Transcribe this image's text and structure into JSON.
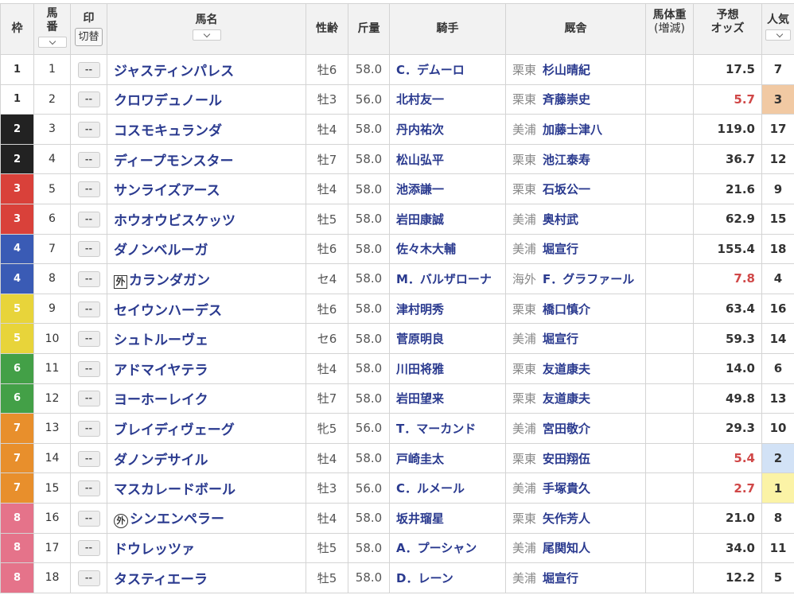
{
  "headers": {
    "waku": "枠",
    "umaban_1": "馬",
    "umaban_2": "番",
    "mark": "印",
    "mark_switch": "切替",
    "horse": "馬名",
    "sexage": "性齢",
    "weight": "斤量",
    "jockey": "騎手",
    "trainer": "厩舎",
    "body_1": "馬体重",
    "body_2": "(増減)",
    "odds_1": "予想",
    "odds_2": "オッズ",
    "pop": "人気"
  },
  "mark_placeholder": "--",
  "waku_colors": {
    "1": {
      "bg": "#ffffff",
      "fg": "#333333"
    },
    "2": {
      "bg": "#222222",
      "fg": "#ffffff"
    },
    "3": {
      "bg": "#d9413a",
      "fg": "#ffffff"
    },
    "4": {
      "bg": "#3a5bb5",
      "fg": "#ffffff"
    },
    "5": {
      "bg": "#e8d43a",
      "fg": "#ffffff"
    },
    "6": {
      "bg": "#43a047",
      "fg": "#ffffff"
    },
    "7": {
      "bg": "#e88f2c",
      "fg": "#ffffff"
    },
    "8": {
      "bg": "#e5738a",
      "fg": "#ffffff"
    }
  },
  "pop_colors": {
    "1": "#fbf3a6",
    "2": "#d2e2f6",
    "3": "#f1c9a3"
  },
  "rows": [
    {
      "waku": "1",
      "num": "1",
      "tag": "",
      "horse": "ジャスティンパレス",
      "sexage": "牡6",
      "weight": "58.0",
      "jockey": "C．デムーロ",
      "region": "栗東",
      "trainer": "杉山晴紀",
      "body": "",
      "odds": "17.5",
      "hot": false,
      "pop": "7"
    },
    {
      "waku": "1",
      "num": "2",
      "tag": "",
      "horse": "クロワデュノール",
      "sexage": "牡3",
      "weight": "56.0",
      "jockey": "北村友一",
      "region": "栗東",
      "trainer": "斉藤崇史",
      "body": "",
      "odds": "5.7",
      "hot": true,
      "pop": "3"
    },
    {
      "waku": "2",
      "num": "3",
      "tag": "",
      "horse": "コスモキュランダ",
      "sexage": "牡4",
      "weight": "58.0",
      "jockey": "丹内祐次",
      "region": "美浦",
      "trainer": "加藤士津八",
      "body": "",
      "odds": "119.0",
      "hot": false,
      "pop": "17"
    },
    {
      "waku": "2",
      "num": "4",
      "tag": "",
      "horse": "ディープモンスター",
      "sexage": "牡7",
      "weight": "58.0",
      "jockey": "松山弘平",
      "region": "栗東",
      "trainer": "池江泰寿",
      "body": "",
      "odds": "36.7",
      "hot": false,
      "pop": "12"
    },
    {
      "waku": "3",
      "num": "5",
      "tag": "",
      "horse": "サンライズアース",
      "sexage": "牡4",
      "weight": "58.0",
      "jockey": "池添謙一",
      "region": "栗東",
      "trainer": "石坂公一",
      "body": "",
      "odds": "21.6",
      "hot": false,
      "pop": "9"
    },
    {
      "waku": "3",
      "num": "6",
      "tag": "",
      "horse": "ホウオウビスケッツ",
      "sexage": "牡5",
      "weight": "58.0",
      "jockey": "岩田康誠",
      "region": "美浦",
      "trainer": "奥村武",
      "body": "",
      "odds": "62.9",
      "hot": false,
      "pop": "15"
    },
    {
      "waku": "4",
      "num": "7",
      "tag": "",
      "horse": "ダノンベルーガ",
      "sexage": "牡6",
      "weight": "58.0",
      "jockey": "佐々木大輔",
      "region": "美浦",
      "trainer": "堀宣行",
      "body": "",
      "odds": "155.4",
      "hot": false,
      "pop": "18"
    },
    {
      "waku": "4",
      "num": "8",
      "tag": "外",
      "tagStyle": "box",
      "horse": "カランダガン",
      "sexage": "セ4",
      "weight": "58.0",
      "jockey": "M．バルザローナ",
      "region": "海外",
      "trainer": "F．グラファール",
      "body": "",
      "odds": "7.8",
      "hot": true,
      "pop": "4"
    },
    {
      "waku": "5",
      "num": "9",
      "tag": "",
      "horse": "セイウンハーデス",
      "sexage": "牡6",
      "weight": "58.0",
      "jockey": "津村明秀",
      "region": "栗東",
      "trainer": "橋口慎介",
      "body": "",
      "odds": "63.4",
      "hot": false,
      "pop": "16"
    },
    {
      "waku": "5",
      "num": "10",
      "tag": "",
      "horse": "シュトルーヴェ",
      "sexage": "セ6",
      "weight": "58.0",
      "jockey": "菅原明良",
      "region": "美浦",
      "trainer": "堀宣行",
      "body": "",
      "odds": "59.3",
      "hot": false,
      "pop": "14"
    },
    {
      "waku": "6",
      "num": "11",
      "tag": "",
      "horse": "アドマイヤテラ",
      "sexage": "牡4",
      "weight": "58.0",
      "jockey": "川田将雅",
      "region": "栗東",
      "trainer": "友道康夫",
      "body": "",
      "odds": "14.0",
      "hot": false,
      "pop": "6"
    },
    {
      "waku": "6",
      "num": "12",
      "tag": "",
      "horse": "ヨーホーレイク",
      "sexage": "牡7",
      "weight": "58.0",
      "jockey": "岩田望来",
      "region": "栗東",
      "trainer": "友道康夫",
      "body": "",
      "odds": "49.8",
      "hot": false,
      "pop": "13"
    },
    {
      "waku": "7",
      "num": "13",
      "tag": "",
      "horse": "ブレイディヴェーグ",
      "sexage": "牝5",
      "weight": "56.0",
      "jockey": "T．マーカンド",
      "region": "美浦",
      "trainer": "宮田敬介",
      "body": "",
      "odds": "29.3",
      "hot": false,
      "pop": "10"
    },
    {
      "waku": "7",
      "num": "14",
      "tag": "",
      "horse": "ダノンデサイル",
      "sexage": "牡4",
      "weight": "58.0",
      "jockey": "戸崎圭太",
      "region": "栗東",
      "trainer": "安田翔伍",
      "body": "",
      "odds": "5.4",
      "hot": true,
      "pop": "2"
    },
    {
      "waku": "7",
      "num": "15",
      "tag": "",
      "horse": "マスカレードボール",
      "sexage": "牡3",
      "weight": "56.0",
      "jockey": "C．ルメール",
      "region": "美浦",
      "trainer": "手塚貴久",
      "body": "",
      "odds": "2.7",
      "hot": true,
      "pop": "1"
    },
    {
      "waku": "8",
      "num": "16",
      "tag": "外",
      "tagStyle": "circle",
      "horse": "シンエンペラー",
      "sexage": "牡4",
      "weight": "58.0",
      "jockey": "坂井瑠星",
      "region": "栗東",
      "trainer": "矢作芳人",
      "body": "",
      "odds": "21.0",
      "hot": false,
      "pop": "8"
    },
    {
      "waku": "8",
      "num": "17",
      "tag": "",
      "horse": "ドウレッツァ",
      "sexage": "牡5",
      "weight": "58.0",
      "jockey": "A．プーシャン",
      "region": "美浦",
      "trainer": "尾関知人",
      "body": "",
      "odds": "34.0",
      "hot": false,
      "pop": "11"
    },
    {
      "waku": "8",
      "num": "18",
      "tag": "",
      "horse": "タスティエーラ",
      "sexage": "牡5",
      "weight": "58.0",
      "jockey": "D．レーン",
      "region": "美浦",
      "trainer": "堀宣行",
      "body": "",
      "odds": "12.2",
      "hot": false,
      "pop": "5"
    }
  ]
}
